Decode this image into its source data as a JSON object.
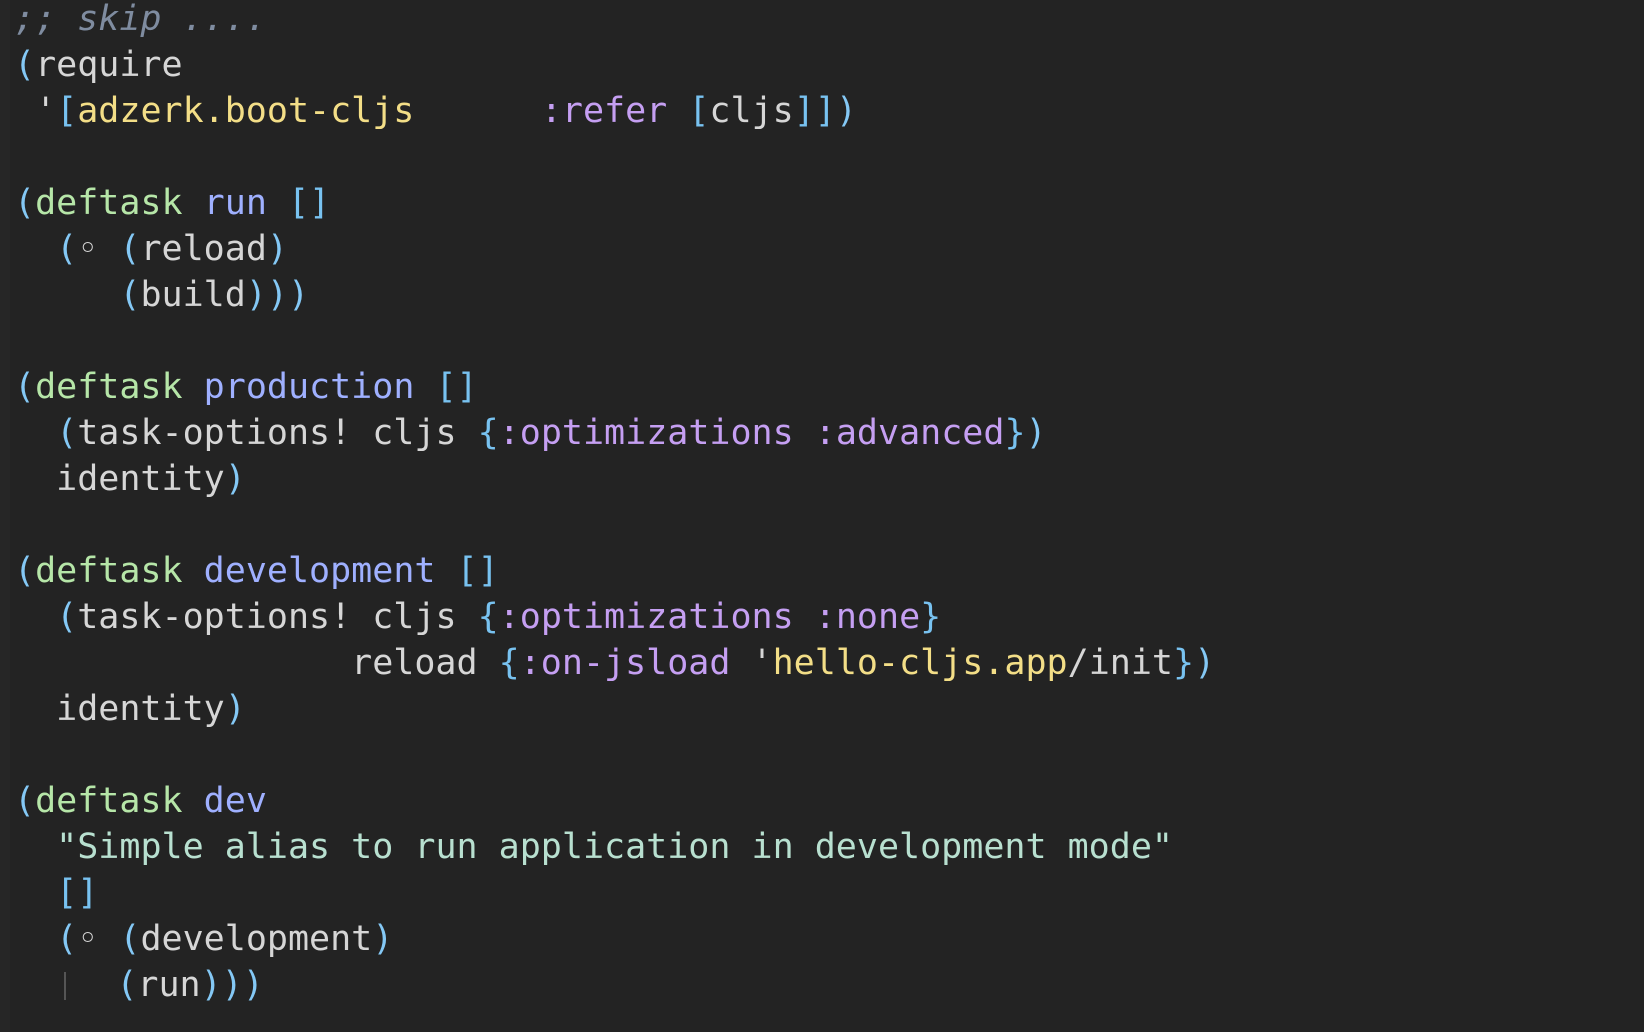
{
  "editor": {
    "language": "clojure",
    "colors": {
      "background": "#232323",
      "comment": "#7f8ca0",
      "paren": "#84c8f5",
      "bracket": "#78c2f0",
      "keyword_def": "#b6e6a8",
      "fn_name": "#9fb0ff",
      "plain": "#d6d6d6",
      "namespace": "#f3de87",
      "clj_keyword": "#c59ff2",
      "string": "#b8e0d0",
      "indent_guide": "#555555"
    },
    "lines": [
      {
        "tokens": [
          {
            "t": ";; skip ....",
            "c": "comment"
          }
        ]
      },
      {
        "tokens": [
          {
            "t": "(",
            "c": "paren"
          },
          {
            "t": "require",
            "c": "plain"
          }
        ]
      },
      {
        "tokens": [
          {
            "t": " '",
            "c": "plain"
          },
          {
            "t": "[",
            "c": "bracket"
          },
          {
            "t": "adzerk.boot-cljs",
            "c": "namespace"
          },
          {
            "t": "      ",
            "c": "plain"
          },
          {
            "t": ":refer",
            "c": "clj_keyword"
          },
          {
            "t": " ",
            "c": "plain"
          },
          {
            "t": "[",
            "c": "bracket"
          },
          {
            "t": "cljs",
            "c": "plain"
          },
          {
            "t": "]]",
            "c": "bracket"
          },
          {
            "t": ")",
            "c": "paren"
          }
        ]
      },
      {
        "tokens": []
      },
      {
        "tokens": [
          {
            "t": "(",
            "c": "paren"
          },
          {
            "t": "deftask",
            "c": "keyword_def"
          },
          {
            "t": " ",
            "c": "plain"
          },
          {
            "t": "run",
            "c": "fn_name"
          },
          {
            "t": " ",
            "c": "plain"
          },
          {
            "t": "[]",
            "c": "bracket"
          }
        ]
      },
      {
        "tokens": [
          {
            "t": "  ",
            "c": "plain"
          },
          {
            "t": "(",
            "c": "paren"
          },
          {
            "t": "◦",
            "c": "plain"
          },
          {
            "t": " ",
            "c": "plain"
          },
          {
            "t": "(",
            "c": "paren"
          },
          {
            "t": "reload",
            "c": "plain"
          },
          {
            "t": ")",
            "c": "paren"
          }
        ]
      },
      {
        "tokens": [
          {
            "t": "     ",
            "c": "plain"
          },
          {
            "t": "(",
            "c": "paren"
          },
          {
            "t": "build",
            "c": "plain"
          },
          {
            "t": ")))",
            "c": "paren"
          }
        ]
      },
      {
        "tokens": []
      },
      {
        "tokens": [
          {
            "t": "(",
            "c": "paren"
          },
          {
            "t": "deftask",
            "c": "keyword_def"
          },
          {
            "t": " ",
            "c": "plain"
          },
          {
            "t": "production",
            "c": "fn_name"
          },
          {
            "t": " ",
            "c": "plain"
          },
          {
            "t": "[]",
            "c": "bracket"
          }
        ]
      },
      {
        "tokens": [
          {
            "t": "  ",
            "c": "plain"
          },
          {
            "t": "(",
            "c": "paren"
          },
          {
            "t": "task-options! cljs ",
            "c": "plain"
          },
          {
            "t": "{",
            "c": "bracket"
          },
          {
            "t": ":optimizations",
            "c": "clj_keyword"
          },
          {
            "t": " ",
            "c": "plain"
          },
          {
            "t": ":advanced",
            "c": "clj_keyword"
          },
          {
            "t": "}",
            "c": "bracket"
          },
          {
            "t": ")",
            "c": "paren"
          }
        ]
      },
      {
        "tokens": [
          {
            "t": "  identity",
            "c": "plain"
          },
          {
            "t": ")",
            "c": "paren"
          }
        ]
      },
      {
        "tokens": []
      },
      {
        "tokens": [
          {
            "t": "(",
            "c": "paren"
          },
          {
            "t": "deftask",
            "c": "keyword_def"
          },
          {
            "t": " ",
            "c": "plain"
          },
          {
            "t": "development",
            "c": "fn_name"
          },
          {
            "t": " ",
            "c": "plain"
          },
          {
            "t": "[]",
            "c": "bracket"
          }
        ]
      },
      {
        "tokens": [
          {
            "t": "  ",
            "c": "plain"
          },
          {
            "t": "(",
            "c": "paren"
          },
          {
            "t": "task-options! cljs ",
            "c": "plain"
          },
          {
            "t": "{",
            "c": "bracket"
          },
          {
            "t": ":optimizations",
            "c": "clj_keyword"
          },
          {
            "t": " ",
            "c": "plain"
          },
          {
            "t": ":none",
            "c": "clj_keyword"
          },
          {
            "t": "}",
            "c": "bracket"
          }
        ]
      },
      {
        "tokens": [
          {
            "t": "                reload ",
            "c": "plain"
          },
          {
            "t": "{",
            "c": "bracket"
          },
          {
            "t": ":on-jsload",
            "c": "clj_keyword"
          },
          {
            "t": " ",
            "c": "plain"
          },
          {
            "t": "'",
            "c": "plain"
          },
          {
            "t": "hello-cljs.app",
            "c": "namespace"
          },
          {
            "t": "/init",
            "c": "plain"
          },
          {
            "t": "}",
            "c": "bracket"
          },
          {
            "t": ")",
            "c": "paren"
          }
        ]
      },
      {
        "tokens": [
          {
            "t": "  identity",
            "c": "plain"
          },
          {
            "t": ")",
            "c": "paren"
          }
        ]
      },
      {
        "tokens": []
      },
      {
        "tokens": [
          {
            "t": "(",
            "c": "paren"
          },
          {
            "t": "deftask",
            "c": "keyword_def"
          },
          {
            "t": " ",
            "c": "plain"
          },
          {
            "t": "dev",
            "c": "fn_name"
          }
        ]
      },
      {
        "tokens": [
          {
            "t": "  ",
            "c": "plain"
          },
          {
            "t": "\"Simple alias to run application in development mode\"",
            "c": "string"
          }
        ]
      },
      {
        "tokens": [
          {
            "t": "  ",
            "c": "plain"
          },
          {
            "t": "[]",
            "c": "bracket"
          }
        ]
      },
      {
        "tokens": [
          {
            "t": "  ",
            "c": "plain"
          },
          {
            "t": "(",
            "c": "paren"
          },
          {
            "t": "◦",
            "c": "plain"
          },
          {
            "t": " ",
            "c": "plain"
          },
          {
            "t": "(",
            "c": "paren"
          },
          {
            "t": "development",
            "c": "plain"
          },
          {
            "t": ")",
            "c": "paren"
          }
        ]
      },
      {
        "tokens": [
          {
            "t": "  ",
            "c": "plain"
          },
          {
            "t": "|",
            "c": "indent_guide"
          },
          {
            "t": "  ",
            "c": "plain"
          },
          {
            "t": "(",
            "c": "paren"
          },
          {
            "t": "run",
            "c": "plain"
          },
          {
            "t": ")))",
            "c": "paren"
          }
        ]
      }
    ]
  }
}
